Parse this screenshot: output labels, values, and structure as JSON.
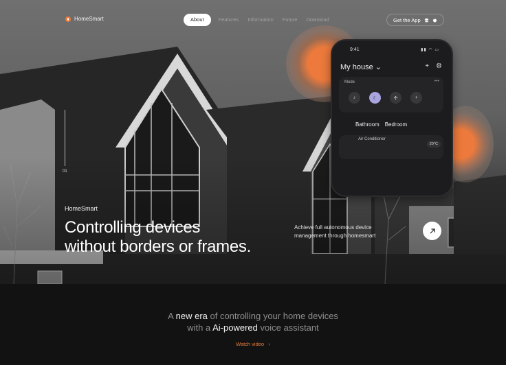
{
  "nav": {
    "brand": "HomeSmart",
    "items": [
      "About",
      "Features",
      "Information",
      "Future",
      "Download"
    ],
    "active_index": 0,
    "cta": "Get the App"
  },
  "hero": {
    "indicator": "01",
    "brand_small": "HomeSmart",
    "headline_line1": "Controlling devices",
    "headline_line2": "without borders or frames.",
    "subtext": "Achieve full autonomous device management through homesmart"
  },
  "phone": {
    "time": "9:41",
    "title": "My house",
    "mode_label": "Mode",
    "rooms": [
      "Bathroom",
      "Bedroom"
    ],
    "device_name": "Air Conditioner",
    "temp": "20°C"
  },
  "bottom": {
    "t1": "A ",
    "t1_em": "new era",
    "t1_rest": " of controlling your home devices",
    "t2": "with a ",
    "t2_em": "Ai-powered",
    "t2_rest": " voice assistant",
    "watch": "Watch video"
  },
  "colors": {
    "accent": "#ea7c3c",
    "background": "#121212"
  }
}
